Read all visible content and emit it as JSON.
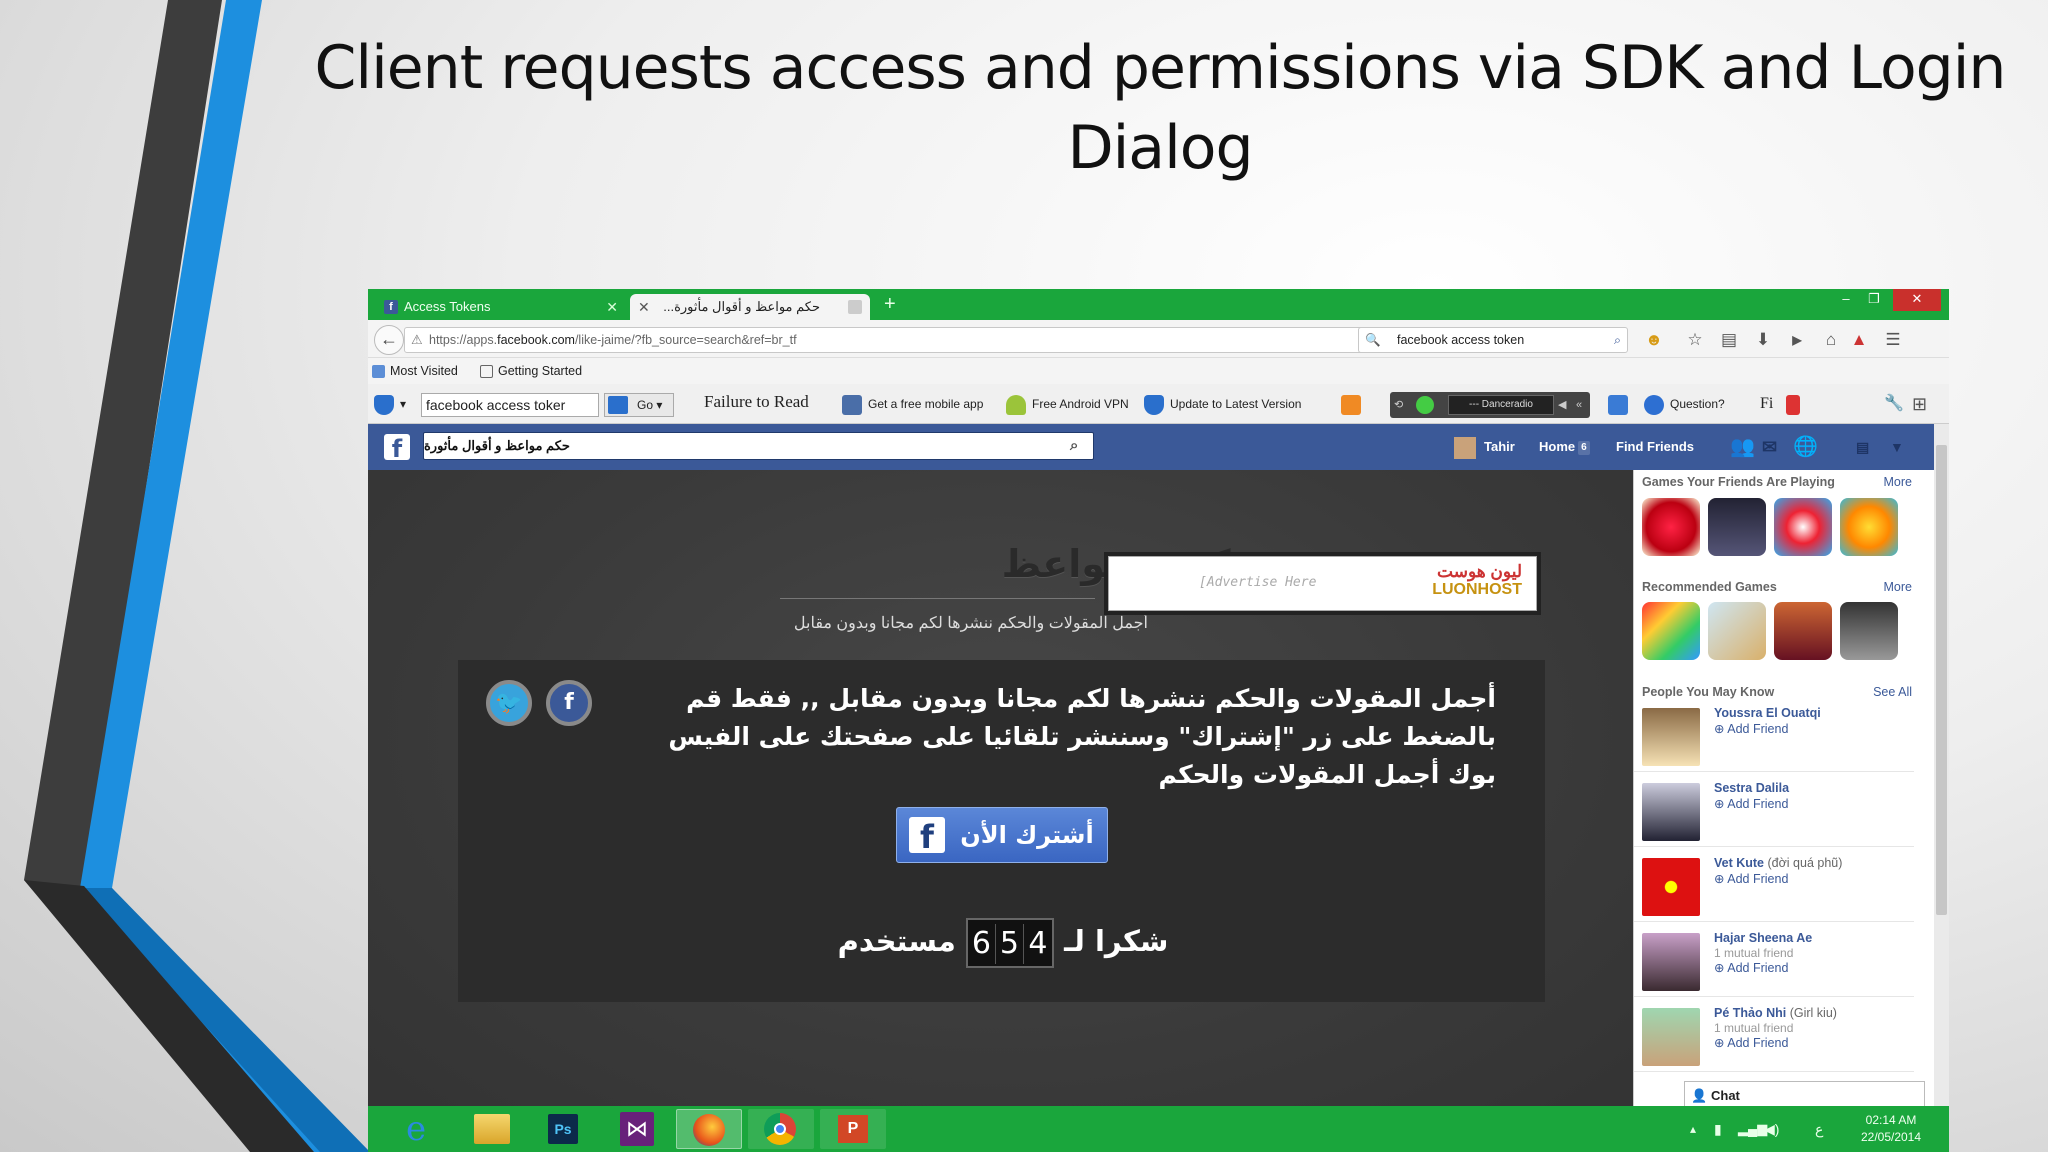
{
  "slide": {
    "title": "Client requests access and permissions via SDK and Login Dialog"
  },
  "browser": {
    "tabs": [
      {
        "label": "Access Tokens"
      },
      {
        "label": "حكم مواعظ و أقوال مأثورة..."
      }
    ],
    "url_prefix": "https://apps.",
    "url_domain": "facebook.com",
    "url_path": "/like-jaime/?fb_source=search&ref=br_tf",
    "search_value": "facebook access token",
    "bookmarks": [
      "Most Visited",
      "Getting Started"
    ],
    "toolbar": {
      "search_value": "facebook access toker",
      "go_label": "Go",
      "failure_text": "Failure to Read",
      "items": [
        "Get a free mobile app",
        "Free Android VPN",
        "Update to Latest Version"
      ],
      "radio_label": "--- Danceradio",
      "question_label": "Question?",
      "fi_label": "Fi"
    }
  },
  "facebook": {
    "search_value": "حكم مواعظ و أقوال مأثورة",
    "user_name": "Tahir",
    "home_label": "Home",
    "home_count": "6",
    "find_friends": "Find Friends"
  },
  "page": {
    "site_title": "حكم و مواعظ",
    "site_subtitle": "أجمل المقولات والحكم ننشرها لكم مجانا وبدون مقابل",
    "ad_placeholder": "[Advertise Here",
    "ad_brand_ar": "ليون هوست",
    "ad_brand_en": "LUONHOST",
    "panel_text": "أجمل المقولات والحكم ننشرها لكم مجانا وبدون مقابل ,, فقط قم بالضغط على زر \"إشتراك\" وسننشر تلقائيا على صفحتك على الفيس بوك أجمل المقولات والحكم",
    "subscribe_label": "أشترك الأن",
    "thanks_prefix": "شكرا لـ",
    "counter_digits": [
      "6",
      "5",
      "4"
    ],
    "thanks_suffix": "مستخدم"
  },
  "sidebar": {
    "games_heading": "Games Your Friends Are Playing",
    "games_more": "More",
    "recommended_heading": "Recommended Games",
    "recommended_more": "More",
    "people_heading": "People You May Know",
    "people_see_all": "See All",
    "add_friend": "Add Friend",
    "people": [
      {
        "name": "Youssra El Ouatqi",
        "note": "",
        "mutual": ""
      },
      {
        "name": "Sestra Dalila",
        "note": "",
        "mutual": ""
      },
      {
        "name": "Vet Kute",
        "note": "(đời quá phũ)",
        "mutual": ""
      },
      {
        "name": "Hajar Sheena Ae",
        "note": "",
        "mutual": "1 mutual friend"
      },
      {
        "name": "Pé Thảo Nhi",
        "note": "(Girl kiu)",
        "mutual": "1 mutual friend"
      }
    ],
    "chat_label": "Chat"
  },
  "taskbar": {
    "time": "02:14 AM",
    "date": "22/05/2014",
    "lang": "ع"
  },
  "colors": {
    "browser_green": "#1aa63c",
    "facebook_blue": "#3b5998",
    "slide_accent_blue": "#1d8fdf"
  }
}
